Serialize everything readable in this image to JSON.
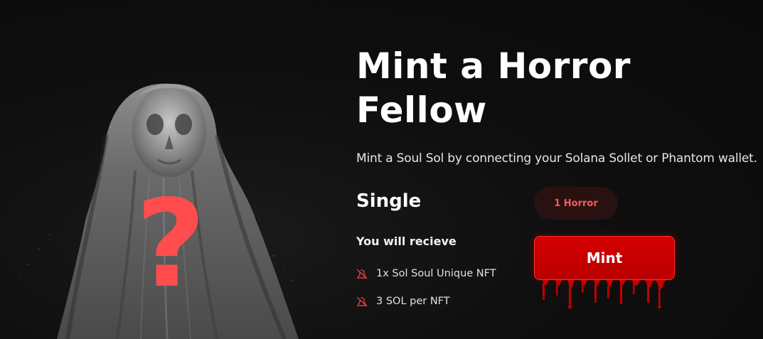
{
  "hero": {
    "title": "Mint a Horror Fellow",
    "subtitle": "Mint a Soul Sol by connecting your Solana Sollet or Phantom wallet.",
    "image_overlay_symbol": "?"
  },
  "plan": {
    "name": "Single",
    "receive_heading": "You will recieve",
    "benefits": [
      {
        "icon": "slash-bell-icon",
        "label": "1x Sol Soul Unique NFT"
      },
      {
        "icon": "slash-bell-icon",
        "label": "3 SOL per NFT"
      }
    ],
    "quantity_label": "1 Horror",
    "mint_label": "Mint"
  },
  "colors": {
    "background": "#0c0c0c",
    "accent_red": "#d60000",
    "question_mark": "#ff4d4d",
    "badge_background": "#2a1111",
    "badge_text": "#ff5a5a"
  }
}
